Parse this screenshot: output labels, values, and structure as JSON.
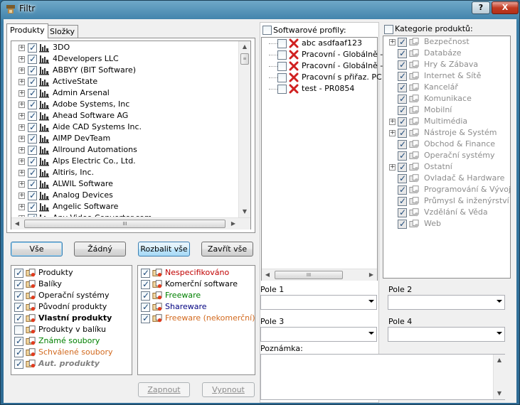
{
  "window": {
    "title": "Filtr",
    "help_label": "?",
    "close_label": "X"
  },
  "tabs": [
    {
      "label": "Produkty"
    },
    {
      "label": "Složky"
    }
  ],
  "vendors": [
    "3DO",
    "4Developers LLC",
    "ABBYY (BIT Software)",
    "ActiveState",
    "Admin Arsenal",
    "Adobe Systems, Inc",
    "Ahead Software AG",
    "Aide CAD Systems Inc.",
    "AIMP DevTeam",
    "Allround Automations",
    "Alps Electric Co., Ltd.",
    "Altiris, Inc.",
    "ALWIL Software",
    "Analog Devices",
    "Angelic Software",
    "Any Video Converter.com"
  ],
  "buttons": {
    "all": "Vše",
    "none": "Žádný",
    "expand": "Rozbalit vše",
    "collapse": "Zavřít vše",
    "enable": "Zapnout",
    "disable": "Vypnout"
  },
  "product_types": [
    {
      "label": "Produkty",
      "checked": true,
      "style": "normal",
      "color": "#000000"
    },
    {
      "label": "Balíky",
      "checked": true,
      "style": "normal",
      "color": "#000000"
    },
    {
      "label": "Operační systémy",
      "checked": true,
      "style": "normal",
      "color": "#000000"
    },
    {
      "label": "Původní produkty",
      "checked": true,
      "style": "normal",
      "color": "#000000"
    },
    {
      "label": "Vlastní produkty",
      "checked": true,
      "style": "bold",
      "color": "#000000"
    },
    {
      "label": "Produkty v balíku",
      "checked": false,
      "style": "normal",
      "color": "#000000"
    },
    {
      "label": "Známé soubory",
      "checked": true,
      "style": "normal",
      "color": "#008000"
    },
    {
      "label": "Schválené soubory",
      "checked": true,
      "style": "normal",
      "color": "#d2691e"
    },
    {
      "label": "Aut. produkty",
      "checked": true,
      "style": "bolditalic",
      "color": "#808080"
    }
  ],
  "licenses": [
    {
      "label": "Nespecifikováno",
      "color": "#c00000"
    },
    {
      "label": "Komerční software",
      "color": "#000000"
    },
    {
      "label": "Freeware",
      "color": "#008000"
    },
    {
      "label": "Shareware",
      "color": "#000080"
    },
    {
      "label": "Freeware (nekomerční)",
      "color": "#d2691e"
    }
  ],
  "profiles": {
    "header": "Softwarové profily:",
    "items": [
      "abc asdfaaf123",
      "Pracovní - Globálně -",
      "Pracovní - Globálně -",
      "Pracovní s přiřaz. PC",
      "test - PR0854"
    ]
  },
  "categories": {
    "header": "Kategorie produktů:",
    "items": [
      {
        "label": "Bezpečnost",
        "expandable": true
      },
      {
        "label": "Databáze",
        "expandable": false
      },
      {
        "label": "Hry & Zábava",
        "expandable": false
      },
      {
        "label": "Internet & Sítě",
        "expandable": false
      },
      {
        "label": "Kancelář",
        "expandable": false
      },
      {
        "label": "Komunikace",
        "expandable": false
      },
      {
        "label": "Mobilní",
        "expandable": false
      },
      {
        "label": "Multimédia",
        "expandable": true
      },
      {
        "label": "Nástroje & Systém",
        "expandable": true
      },
      {
        "label": "Obchod & Finance",
        "expandable": false
      },
      {
        "label": "Operační systémy",
        "expandable": false
      },
      {
        "label": "Ostatní",
        "expandable": true
      },
      {
        "label": "Ovladač & Hardware",
        "expandable": false
      },
      {
        "label": "Programování & Vývoj",
        "expandable": false
      },
      {
        "label": "Průmysl & inženýrství",
        "expandable": false
      },
      {
        "label": "Vzdělání & Věda",
        "expandable": false
      },
      {
        "label": "Web",
        "expandable": false
      }
    ]
  },
  "fields": {
    "pole1": "Pole 1",
    "pole2": "Pole 2",
    "pole3": "Pole 3",
    "pole4": "Pole 4",
    "note": "Poznámka:"
  },
  "icons": {
    "scroll_up": "▲",
    "scroll_down": "▼",
    "scroll_left": "◀",
    "scroll_right": "▶",
    "expand": "+",
    "grip_v": "≡",
    "grip_h": "III"
  }
}
